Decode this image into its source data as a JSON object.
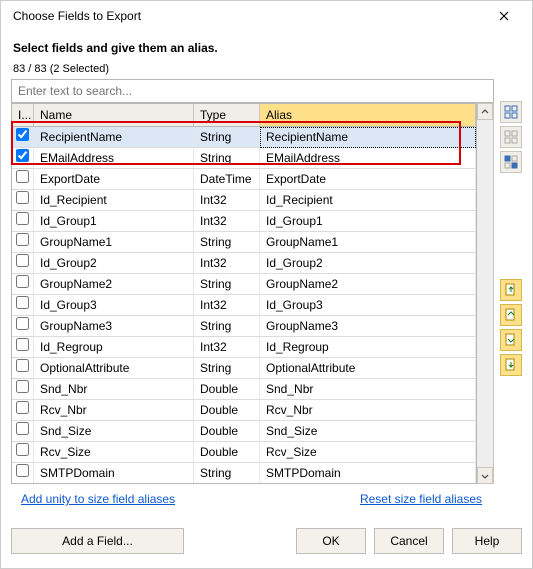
{
  "window": {
    "title": "Choose Fields to Export"
  },
  "instruction": "Select fields and give them an alias.",
  "count_text": "83 / 83 (2 Selected)",
  "search": {
    "placeholder": "Enter text to search..."
  },
  "columns": {
    "c0": "I...",
    "c1": "Name",
    "c2": "Type",
    "c3": "Alias"
  },
  "rows": [
    {
      "checked": true,
      "name": "RecipientName",
      "type": "String",
      "alias": "RecipientName"
    },
    {
      "checked": true,
      "name": "EMailAddress",
      "type": "String",
      "alias": "EMailAddress"
    },
    {
      "checked": false,
      "name": "ExportDate",
      "type": "DateTime",
      "alias": "ExportDate"
    },
    {
      "checked": false,
      "name": "Id_Recipient",
      "type": "Int32",
      "alias": "Id_Recipient"
    },
    {
      "checked": false,
      "name": "Id_Group1",
      "type": "Int32",
      "alias": "Id_Group1"
    },
    {
      "checked": false,
      "name": "GroupName1",
      "type": "String",
      "alias": "GroupName1"
    },
    {
      "checked": false,
      "name": "Id_Group2",
      "type": "Int32",
      "alias": "Id_Group2"
    },
    {
      "checked": false,
      "name": "GroupName2",
      "type": "String",
      "alias": "GroupName2"
    },
    {
      "checked": false,
      "name": "Id_Group3",
      "type": "Int32",
      "alias": "Id_Group3"
    },
    {
      "checked": false,
      "name": "GroupName3",
      "type": "String",
      "alias": "GroupName3"
    },
    {
      "checked": false,
      "name": "Id_Regroup",
      "type": "Int32",
      "alias": "Id_Regroup"
    },
    {
      "checked": false,
      "name": "OptionalAttribute",
      "type": "String",
      "alias": "OptionalAttribute"
    },
    {
      "checked": false,
      "name": "Snd_Nbr",
      "type": "Double",
      "alias": "Snd_Nbr"
    },
    {
      "checked": false,
      "name": "Rcv_Nbr",
      "type": "Double",
      "alias": "Rcv_Nbr"
    },
    {
      "checked": false,
      "name": "Snd_Size",
      "type": "Double",
      "alias": "Snd_Size"
    },
    {
      "checked": false,
      "name": "Rcv_Size",
      "type": "Double",
      "alias": "Rcv_Size"
    },
    {
      "checked": false,
      "name": "SMTPDomain",
      "type": "String",
      "alias": "SMTPDomain"
    }
  ],
  "links": {
    "left": "Add unity to size field aliases",
    "right": "Reset size field aliases"
  },
  "buttons": {
    "add_field": "Add a Field...",
    "ok": "OK",
    "cancel": "Cancel",
    "help": "Help"
  }
}
